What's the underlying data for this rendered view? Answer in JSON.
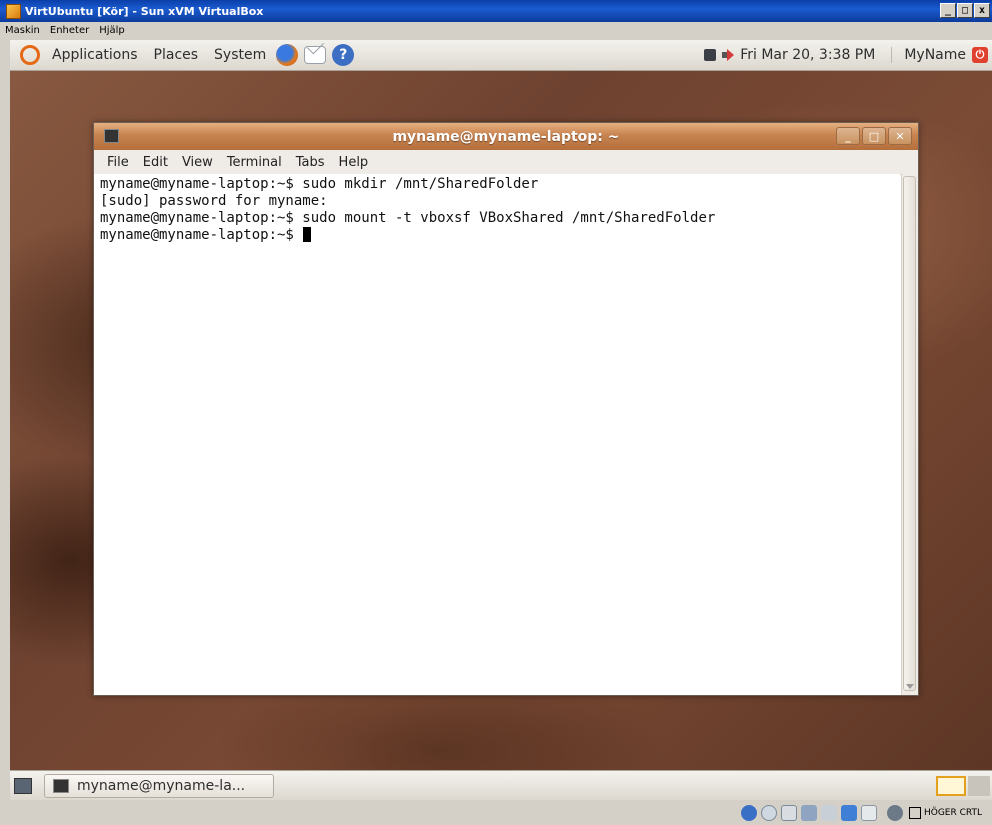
{
  "host": {
    "title": "VirtUbuntu [Kör] - Sun xVM VirtualBox",
    "window_buttons": [
      "_",
      "□",
      "x"
    ],
    "menu": [
      "Maskin",
      "Enheter",
      "Hjälp"
    ],
    "status_key": "HÖGER CRTL"
  },
  "top_panel": {
    "menus": [
      "Applications",
      "Places",
      "System"
    ],
    "clock": "Fri Mar 20,  3:38 PM",
    "user": "MyName"
  },
  "terminal": {
    "title": "myname@myname-laptop: ~",
    "menu": [
      "File",
      "Edit",
      "View",
      "Terminal",
      "Tabs",
      "Help"
    ],
    "lines": [
      "myname@myname-laptop:~$ sudo mkdir /mnt/SharedFolder",
      "[sudo] password for myname:",
      "myname@myname-laptop:~$ sudo mount -t vboxsf VBoxShared /mnt/SharedFolder"
    ],
    "prompt": "myname@myname-laptop:~$ "
  },
  "bottom_panel": {
    "task_label": "myname@myname-la..."
  },
  "colors": {
    "accent_orange": "#c78350",
    "ubuntu_orange": "#e66a16",
    "host_titlebar": "#0a3fa8"
  }
}
